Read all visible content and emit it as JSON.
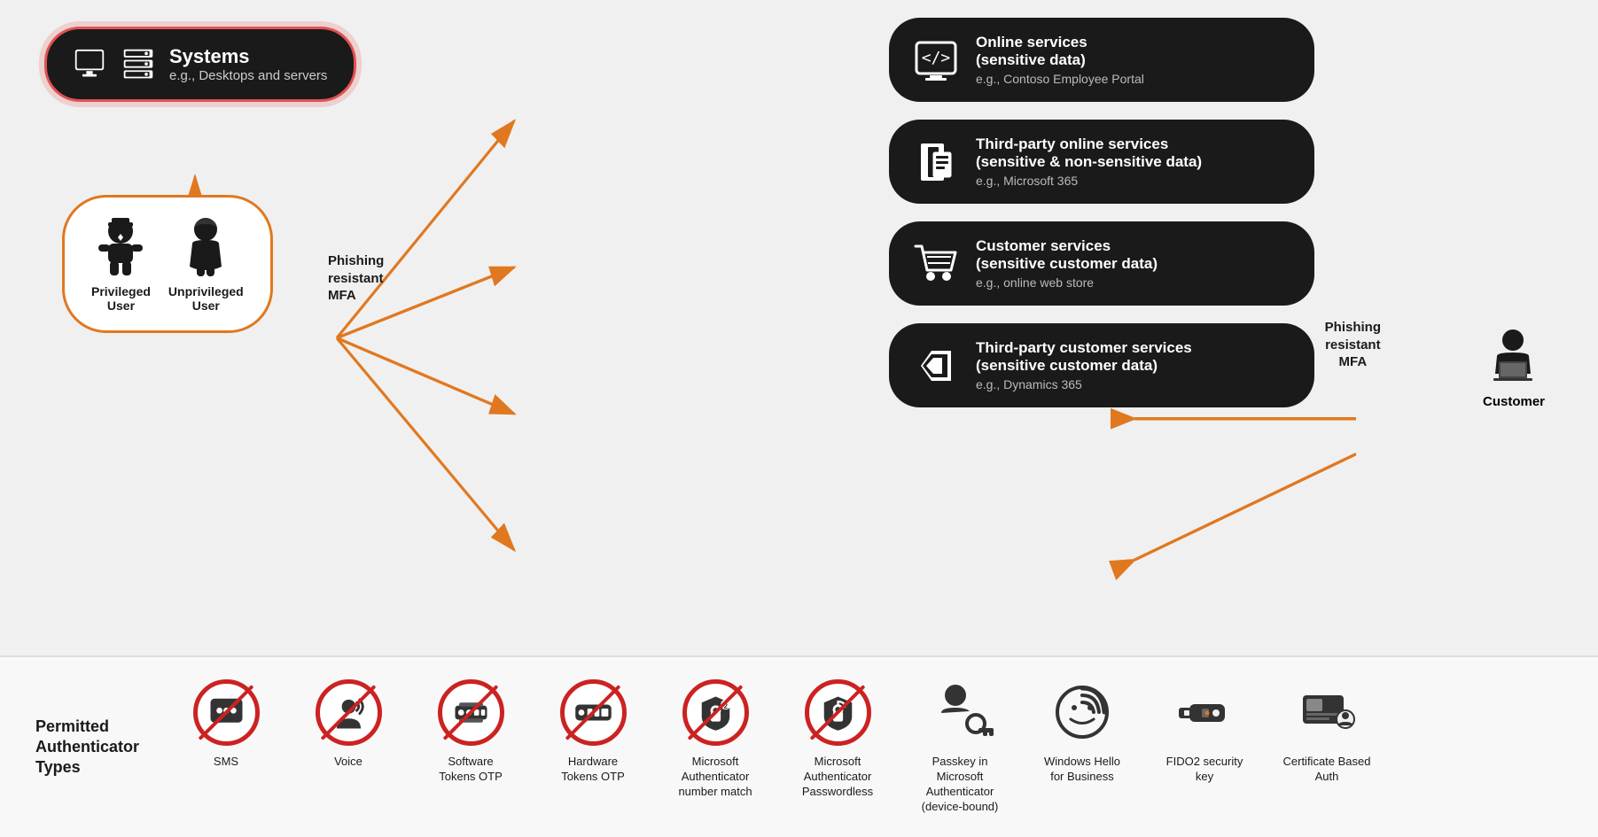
{
  "diagram": {
    "systems_title": "Systems",
    "systems_sub": "e.g., Desktops and servers",
    "users": [
      {
        "label": "Privileged\nUser"
      },
      {
        "label": "Unprivileged\nUser"
      }
    ],
    "phishing_left_label": "Phishing\nresistant\nMFA",
    "phishing_right_label": "Phishing\nresistant\nMFA",
    "services": [
      {
        "title": "Online services\n(sensitive data)",
        "sub": "e.g., Contoso Employee Portal",
        "icon": "web-icon"
      },
      {
        "title": "Third-party online services\n(sensitive & non-sensitive data)",
        "sub": "e.g., Microsoft 365",
        "icon": "office-icon"
      },
      {
        "title": "Customer services\n(sensitive customer data)",
        "sub": "e.g., online web store",
        "icon": "cart-icon"
      },
      {
        "title": "Third-party customer services\n(sensitive customer data)",
        "sub": "e.g., Dynamics 365",
        "icon": "dynamics-icon"
      }
    ],
    "customer_label": "Customer"
  },
  "authenticator": {
    "section_title": "Permitted\nAuthenticator\nTypes",
    "items": [
      {
        "label": "SMS",
        "type": "banned",
        "icon": "sms-icon"
      },
      {
        "label": "Voice",
        "type": "banned",
        "icon": "voice-icon"
      },
      {
        "label": "Software\nTokens OTP",
        "type": "banned",
        "icon": "software-token-icon"
      },
      {
        "label": "Hardware\nTokens OTP",
        "type": "banned",
        "icon": "hardware-token-icon"
      },
      {
        "label": "Microsoft\nAuthenticator\nnumber match",
        "type": "banned",
        "icon": "ms-auth-number-icon"
      },
      {
        "label": "Microsoft\nAuthenticator\nPasswordless",
        "type": "banned",
        "icon": "ms-auth-pass-icon"
      },
      {
        "label": "Passkey in\nMicrosoft\nAuthenticator\n(device-bound)",
        "type": "allowed",
        "icon": "passkey-icon"
      },
      {
        "label": "Windows Hello\nfor Business",
        "type": "allowed",
        "icon": "windows-hello-icon"
      },
      {
        "label": "FIDO2 security\nkey",
        "type": "allowed",
        "icon": "fido2-icon"
      },
      {
        "label": "Certificate Based\nAuth",
        "type": "allowed",
        "icon": "cert-icon"
      }
    ]
  }
}
